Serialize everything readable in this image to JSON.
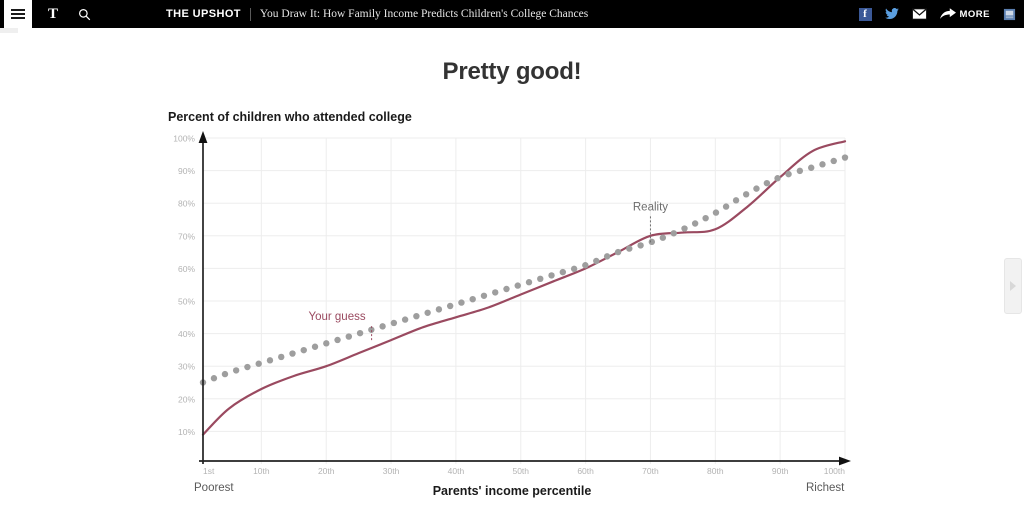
{
  "topbar": {
    "menu_icon": "hamburger-icon",
    "logo_text": "T",
    "search_icon": "search-icon",
    "section_kicker": "THE UPSHOT",
    "article_title": "You Draw It: How Family Income Predicts Children's College Chances",
    "share": {
      "facebook_label": "f",
      "twitter_icon": "twitter-icon",
      "email_icon": "email-icon",
      "share_icon": "share-arrow-icon",
      "more_label": "MORE",
      "save_icon": "save-icon"
    }
  },
  "headline": "Pretty good!",
  "chart_data": {
    "type": "line",
    "title": "Percent of children who attended college",
    "xlabel": "Parents' income percentile",
    "ylabel": "",
    "xlim": [
      1,
      100
    ],
    "ylim": [
      0,
      100
    ],
    "grid": true,
    "x_tick_labels": [
      "1st",
      "10th",
      "20th",
      "30th",
      "40th",
      "50th",
      "60th",
      "70th",
      "80th",
      "90th",
      "100th"
    ],
    "x_tick_values": [
      1,
      10,
      20,
      30,
      40,
      50,
      60,
      70,
      80,
      90,
      100
    ],
    "y_tick_labels": [
      "10%",
      "20%",
      "30%",
      "40%",
      "50%",
      "60%",
      "70%",
      "80%",
      "90%",
      "100%"
    ],
    "y_tick_values": [
      10,
      20,
      30,
      40,
      50,
      60,
      70,
      80,
      90,
      100
    ],
    "x_axis_end_labels": {
      "left": "Poorest",
      "right": "Richest"
    },
    "colors": {
      "your_guess": "#9a4a60",
      "reality": "#9e9e9e",
      "axis": "#222222",
      "grid": "#ededed",
      "tick_text": "#b3b3b3"
    },
    "series": [
      {
        "name": "Your guess",
        "style": "solid",
        "color": "#9a4a60",
        "annotation": "Your guess",
        "annotation_at_x": 27,
        "x": [
          1,
          5,
          10,
          15,
          20,
          25,
          30,
          35,
          40,
          45,
          50,
          55,
          60,
          65,
          70,
          75,
          80,
          85,
          90,
          95,
          100
        ],
        "values": [
          9,
          17,
          23,
          27,
          30,
          34,
          38,
          42,
          45,
          48,
          52,
          56,
          60,
          65,
          70,
          71,
          72,
          79,
          88,
          96,
          99
        ]
      },
      {
        "name": "Reality",
        "style": "dotted",
        "color": "#9e9e9e",
        "annotation": "Reality",
        "annotation_at_x": 70,
        "x": [
          1,
          5,
          10,
          15,
          20,
          25,
          30,
          35,
          40,
          45,
          50,
          55,
          60,
          65,
          70,
          75,
          80,
          85,
          90,
          95,
          100
        ],
        "values": [
          25,
          28,
          31,
          34,
          37,
          40,
          43,
          46,
          49,
          52,
          55,
          58,
          61,
          65,
          68,
          72,
          77,
          83,
          88,
          91,
          94
        ]
      }
    ]
  },
  "edge_nav": {
    "next_icon": "chevron-right-icon"
  }
}
